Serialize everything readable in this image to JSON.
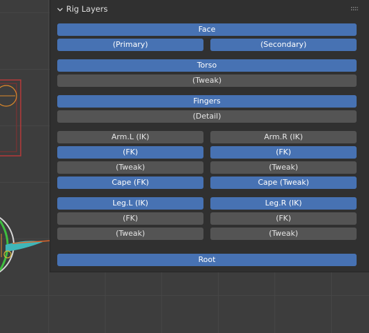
{
  "panel": {
    "title": "Rig Layers",
    "collapse_icon": "chevron-down-icon",
    "grip_icon": "drag-grip-icon"
  },
  "colors": {
    "active": "#4772b3",
    "inactive": "#545454",
    "panel_bg": "#303030",
    "viewport_bg": "#3d3d3d"
  },
  "layers": {
    "face": {
      "label": "Face",
      "active": true
    },
    "face_primary": {
      "label": "(Primary)",
      "active": true
    },
    "face_secondary": {
      "label": "(Secondary)",
      "active": true
    },
    "torso": {
      "label": "Torso",
      "active": true
    },
    "torso_tweak": {
      "label": "(Tweak)",
      "active": false
    },
    "fingers": {
      "label": "Fingers",
      "active": true
    },
    "fingers_detail": {
      "label": "(Detail)",
      "active": false
    },
    "arm_l_ik": {
      "label": "Arm.L (IK)",
      "active": false
    },
    "arm_r_ik": {
      "label": "Arm.R (IK)",
      "active": false
    },
    "arm_l_fk": {
      "label": "(FK)",
      "active": true
    },
    "arm_r_fk": {
      "label": "(FK)",
      "active": true
    },
    "arm_l_tweak": {
      "label": "(Tweak)",
      "active": false
    },
    "arm_r_tweak": {
      "label": "(Tweak)",
      "active": false
    },
    "cape_fk": {
      "label": "Cape (FK)",
      "active": true
    },
    "cape_tweak": {
      "label": "Cape (Tweak)",
      "active": true
    },
    "leg_l_ik": {
      "label": "Leg.L (IK)",
      "active": true
    },
    "leg_r_ik": {
      "label": "Leg.R (IK)",
      "active": true
    },
    "leg_l_fk": {
      "label": "(FK)",
      "active": false
    },
    "leg_r_fk": {
      "label": "(FK)",
      "active": false
    },
    "leg_l_tweak": {
      "label": "(Tweak)",
      "active": false
    },
    "leg_r_tweak": {
      "label": "(Tweak)",
      "active": false
    },
    "root": {
      "label": "Root",
      "active": true
    }
  }
}
